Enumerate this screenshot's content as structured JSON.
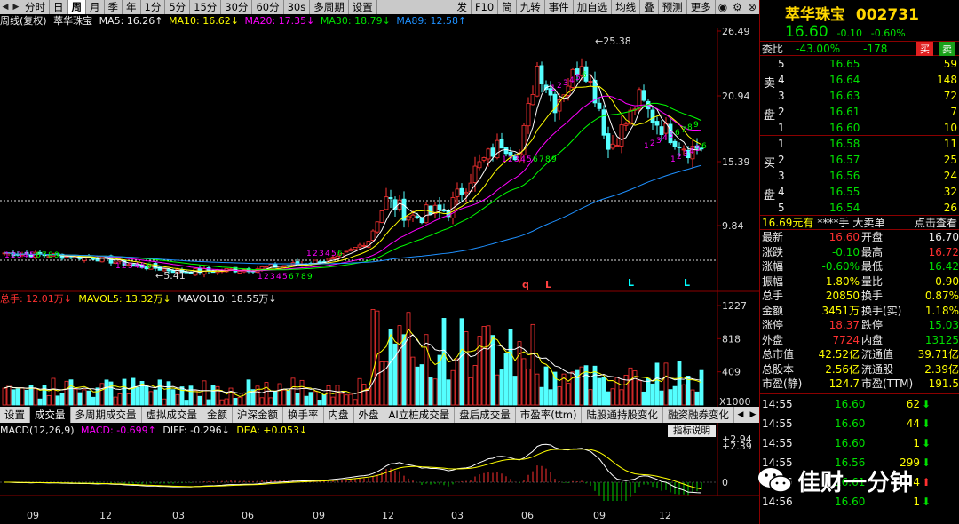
{
  "toolbar": {
    "items": [
      "分时",
      "日",
      "周",
      "月",
      "季",
      "年",
      "1分",
      "5分",
      "15分",
      "30分",
      "60分",
      "30s",
      "多周期",
      "设置"
    ],
    "selected_index": 2,
    "right_items": [
      "发",
      "F10",
      "简",
      "九转",
      "事件",
      "加自选",
      "均线",
      "叠",
      "预测",
      "更多"
    ]
  },
  "ma": {
    "period_label": "周线(复权)",
    "stock_name": "萃华珠宝",
    "ma5": "MA5: 16.26↑",
    "ma10": "MA10: 16.62↓",
    "ma20": "MA20: 17.35↓",
    "ma30": "MA30: 18.79↓",
    "ma89": "MA89: 12.58↑"
  },
  "price_axis": [
    "26.49",
    "20.94",
    "15.39",
    "9.84"
  ],
  "price_marks": {
    "high": "25.38",
    "low": "5.41"
  },
  "vol_line": {
    "total": "总手: 12.01万↓",
    "mavol5": "MAVOL5: 13.32万↓",
    "mavol10": "MAVOL10: 18.55万↓"
  },
  "vol_axis": [
    "1227",
    "818",
    "409"
  ],
  "vol_unit": "X1000",
  "tabs": [
    "设置",
    "成交量",
    "多周期成交量",
    "虚拟成交量",
    "金额",
    "沪深金额",
    "换手率",
    "内盘",
    "外盘",
    "AI立桩成交量",
    "盘后成交量",
    "市盈率(ttm)",
    "陆股通持股变化",
    "融资融券变化"
  ],
  "tab_selected": 1,
  "macd_line": {
    "macd": "MACD(12,26,9)",
    "macd_val": "MACD: -0.699↑",
    "diff": "DIFF: -0.296↓",
    "dea": "DEA: +0.053↓"
  },
  "hint_btn": "指标说明",
  "macd_axis": [
    "+2.94",
    "+2.39",
    "0"
  ],
  "time_axis": [
    "09",
    "12",
    "03",
    "06",
    "09",
    "12",
    "03",
    "06",
    "09",
    "12"
  ],
  "chart_markers": [
    "q",
    "L",
    "L",
    "L"
  ],
  "candle_seq_labels": [
    "1",
    "2",
    "3",
    "4",
    "5",
    "6",
    "7",
    "8",
    "9"
  ],
  "side": {
    "name": "萃华珠宝",
    "code": "002731",
    "price": "16.60",
    "change": "-0.10",
    "pct": "-0.60%",
    "weibi_label": "委比",
    "weibi": "-43.00%",
    "weicha": "-178",
    "buy_btn": "买",
    "sell_btn": "卖",
    "sell_label": [
      "卖",
      "盘"
    ],
    "buy_label": [
      "买",
      "盘"
    ],
    "asks": [
      {
        "lvl": "5",
        "price": "16.65",
        "vol": "59"
      },
      {
        "lvl": "4",
        "price": "16.64",
        "vol": "148"
      },
      {
        "lvl": "3",
        "price": "16.63",
        "vol": "72"
      },
      {
        "lvl": "2",
        "price": "16.61",
        "vol": "7"
      },
      {
        "lvl": "1",
        "price": "16.60",
        "vol": "10"
      }
    ],
    "bids": [
      {
        "lvl": "1",
        "price": "16.58",
        "vol": "11"
      },
      {
        "lvl": "2",
        "price": "16.57",
        "vol": "25"
      },
      {
        "lvl": "3",
        "price": "16.56",
        "vol": "24"
      },
      {
        "lvl": "4",
        "price": "16.55",
        "vol": "32"
      },
      {
        "lvl": "5",
        "price": "16.54",
        "vol": "26"
      }
    ],
    "bigorder": {
      "price": "16.69元有",
      "hands": "****手",
      "label": "大卖单",
      "link": "点击查看"
    },
    "stats": [
      {
        "k1": "最新",
        "v1": "16.60",
        "c1": "red",
        "k2": "开盘",
        "v2": "16.70",
        "c2": "wht"
      },
      {
        "k1": "涨跌",
        "v1": "-0.10",
        "c1": "grn",
        "k2": "最高",
        "v2": "16.72",
        "c2": "red"
      },
      {
        "k1": "涨幅",
        "v1": "-0.60%",
        "c1": "grn",
        "k2": "最低",
        "v2": "16.42",
        "c2": "grn"
      },
      {
        "k1": "振幅",
        "v1": "1.80%",
        "c1": "yel",
        "k2": "量比",
        "v2": "0.90",
        "c2": "yel"
      },
      {
        "k1": "总手",
        "v1": "20850",
        "c1": "yel",
        "k2": "换手",
        "v2": "0.87%",
        "c2": "yel"
      },
      {
        "k1": "金额",
        "v1": "3451万",
        "c1": "yel",
        "k2": "换手(实)",
        "v2": "1.18%",
        "c2": "yel"
      },
      {
        "k1": "涨停",
        "v1": "18.37",
        "c1": "red",
        "k2": "跌停",
        "v2": "15.03",
        "c2": "grn"
      },
      {
        "k1": "外盘",
        "v1": "7724",
        "c1": "red",
        "k2": "内盘",
        "v2": "13125",
        "c2": "grn"
      },
      {
        "k1": "总市值",
        "v1": "42.52亿",
        "c1": "yel",
        "k2": "流通值",
        "v2": "39.71亿",
        "c2": "yel"
      },
      {
        "k1": "总股本",
        "v1": "2.56亿",
        "c1": "yel",
        "k2": "流通股",
        "v2": "2.39亿",
        "c2": "yel"
      },
      {
        "k1": "市盈(静)",
        "v1": "124.7",
        "c1": "yel",
        "k2": "市盈(TTM)",
        "v2": "191.5",
        "c2": "yel"
      }
    ],
    "ticks": [
      {
        "time": "14:55",
        "price": "16.60",
        "vol": "62",
        "dir": "down"
      },
      {
        "time": "14:55",
        "price": "16.60",
        "vol": "44",
        "dir": "down"
      },
      {
        "time": "14:55",
        "price": "16.60",
        "vol": "1",
        "dir": "down"
      },
      {
        "time": "14:55",
        "price": "16.56",
        "vol": "299",
        "dir": "down"
      },
      {
        "time": "14:56",
        "price": "16.61",
        "vol": "4",
        "dir": "up"
      },
      {
        "time": "14:56",
        "price": "16.60",
        "vol": "1",
        "dir": "down"
      }
    ],
    "watermark": "佳财一分钟"
  },
  "colors": {
    "up": "#ff3232",
    "down": "#54ffff",
    "ma5": "#ffffff",
    "ma10": "#ffff00",
    "ma20": "#ff00ff",
    "ma30": "#00ff00",
    "ma89": "#1e90ff"
  }
}
